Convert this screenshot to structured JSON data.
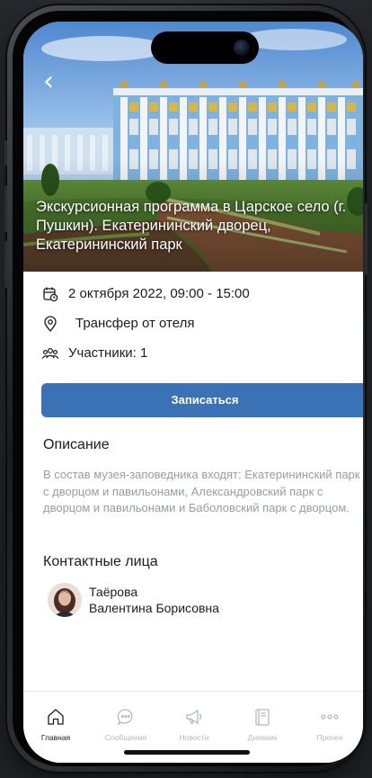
{
  "hero": {
    "back_icon": "chevron-left-icon",
    "title": "Экскурсионная программа в Царское село (г. Пушкин). Екатерининский дворец, Екатерининский парк"
  },
  "info": {
    "datetime": "2 октября 2022, 09:00 - 15:00",
    "transfer": "Трансфер от отеля",
    "participants": "Участники: 1"
  },
  "actions": {
    "signup_label": "Записаться",
    "accent_color": "#3b72b6"
  },
  "description": {
    "title": "Описание",
    "text": "В состав музея-заповедника входят: Екатерининский парк с дворцом и павильонами, Александровский парк с дворцом и павильонами и Баболовский парк с дворцом."
  },
  "contacts": {
    "title": "Контактные лица",
    "person": {
      "surname": "Таёрова",
      "name": "Валентина Борисовна"
    }
  },
  "tabbar": {
    "active_index": 0,
    "items": [
      {
        "label": "Главная",
        "icon": "home-icon"
      },
      {
        "label": "Сообщения",
        "icon": "chat-bubble-icon"
      },
      {
        "label": "Новости",
        "icon": "megaphone-icon"
      },
      {
        "label": "Дневник",
        "icon": "notebook-icon"
      },
      {
        "label": "Прочее",
        "icon": "more-dots-icon"
      }
    ]
  }
}
